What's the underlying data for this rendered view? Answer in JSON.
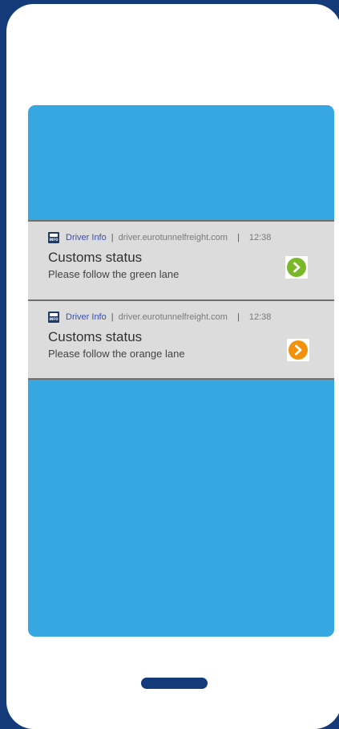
{
  "colors": {
    "frame": "#143a7a",
    "screen": "#37a7e1",
    "notification_bg": "#dcdcdc",
    "green_accent": "#7ab829",
    "orange_accent": "#f2920c"
  },
  "notifications": [
    {
      "app_name": "Driver Info",
      "separator": "|",
      "domain": "driver.eurotunnelfreight.com",
      "separator2": "|",
      "time": "12:38",
      "title": "Customs status",
      "body": "Please follow the green lane",
      "action_icon": "chevron-right-green-icon",
      "color": "#7ab829"
    },
    {
      "app_name": "Driver Info",
      "separator": "|",
      "domain": "driver.eurotunnelfreight.com",
      "separator2": "|",
      "time": "12:38",
      "title": "Customs status",
      "body": "Please follow the orange lane",
      "action_icon": "chevron-right-orange-icon",
      "color": "#f2920c"
    }
  ],
  "app_icon_text": "INFO"
}
